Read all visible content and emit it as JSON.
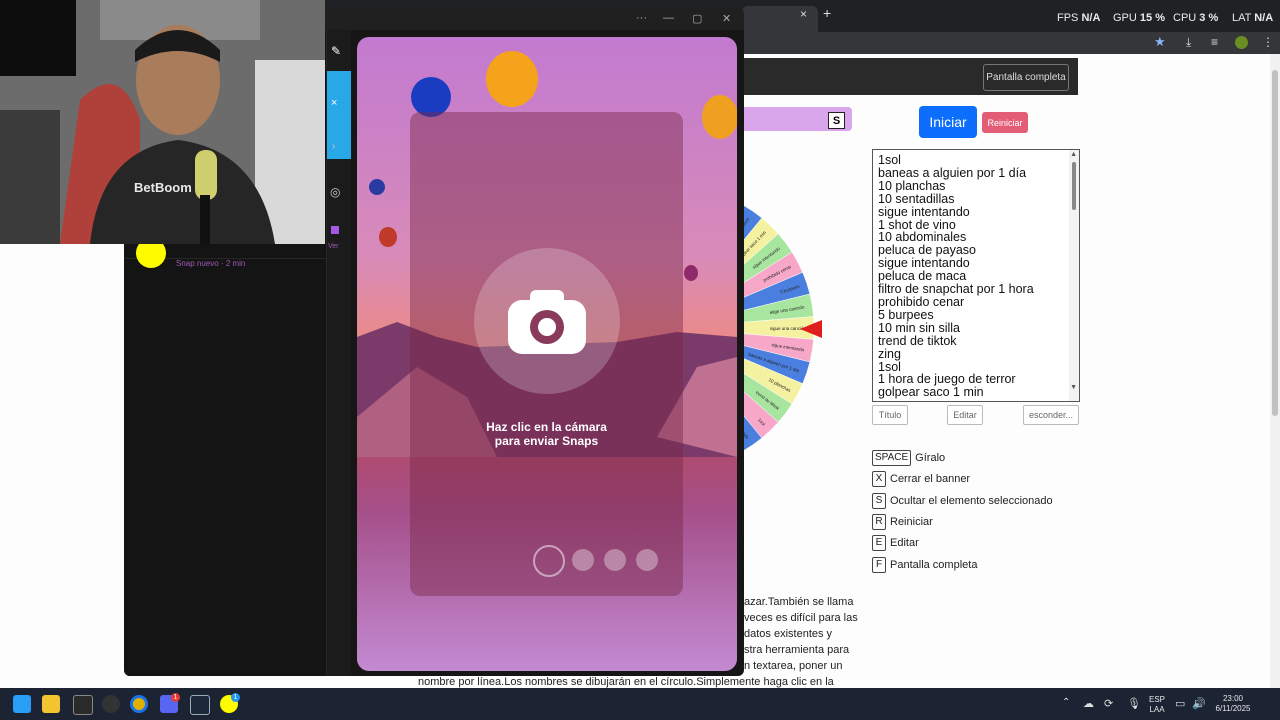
{
  "overlay": {
    "fps_label": "FPS",
    "fps_value": "N/A",
    "gpu_label": "GPU",
    "gpu_value": "15 %",
    "cpu_label": "CPU",
    "cpu_value": "3 %",
    "lat_label": "LAT",
    "lat_value": "N/A"
  },
  "browser": {
    "new_tab_label": "+",
    "close_tab_label": "×"
  },
  "page": {
    "fullscreen_label": "Pantalla completa",
    "s_key_label": "S",
    "start_label": "Iniciar",
    "reset_label": "Reiniciar",
    "names": [
      "1sol",
      "baneas a alguien por 1 día",
      "10 planchas",
      "10 sentadillas",
      "sigue intentando",
      "1 shot de vino",
      "10 abdominales",
      "peluca de payaso",
      "sigue intentando",
      "peluca de maca",
      "filtro de snapchat por 1 hora",
      "prohibido cenar",
      "5 burpees",
      "10 min sin silla",
      "trend de tiktok",
      "zing",
      "1sol",
      "1 hora de juego de terror",
      "golpear saco 1 min"
    ],
    "title_btn_label": "Título",
    "edit_btn_label": "Editar",
    "hide_btn_label": "esconder...",
    "shortcuts": [
      {
        "key": "SPACE",
        "label": "Gíralo"
      },
      {
        "key": "X",
        "label": "Cerrar el banner"
      },
      {
        "key": "S",
        "label": "Ocultar el elemento seleccionado"
      },
      {
        "key": "R",
        "label": "Reiniciar"
      },
      {
        "key": "E",
        "label": "Editar"
      },
      {
        "key": "F",
        "label": "Pantalla completa"
      }
    ],
    "desc_lines": [
      "azar.También se llama",
      "veces es difícil para las",
      "datos existentes y",
      "stra herramienta para",
      "n textarea, poner un",
      "nombre por línea.Los nombres se dibujarán en el círculo.Simplemente haga clic en la rueda"
    ],
    "wheel_labels": [
      "1 hora de juego de terror",
      "golpear saco 1 min",
      "sigue intentando",
      "prohibido cenar",
      "5 burpees",
      "elige una canción",
      "sigue una canción",
      "sigue intentando",
      "baneas a alguien por 1 día",
      "10 planchas",
      "trend de tiktok",
      "1sol",
      "sigue intentando"
    ]
  },
  "snap": {
    "win_more": "···",
    "win_min": "—",
    "win_max": "▢",
    "win_close": "✕",
    "chat_snippet": "Snap nuevo · 2 min",
    "rail_view": "Ver",
    "camera_prompt_line1": "Haz clic en la cámara",
    "camera_prompt_line2": "para enviar Snaps"
  },
  "webcam": {
    "shirt_text": "BetBoom"
  },
  "taskbar": {
    "lang_line1": "ESP",
    "lang_line2": "LAA",
    "time": "23:00",
    "date": "6/11/2025",
    "discord_badge": "1",
    "app_badge": "1"
  },
  "colors": {
    "accent_blue": "#0d6efd",
    "reset_pink": "#e35d77",
    "purple_bar": "#d9a6ec",
    "snap_yellow": "#fffc00"
  }
}
